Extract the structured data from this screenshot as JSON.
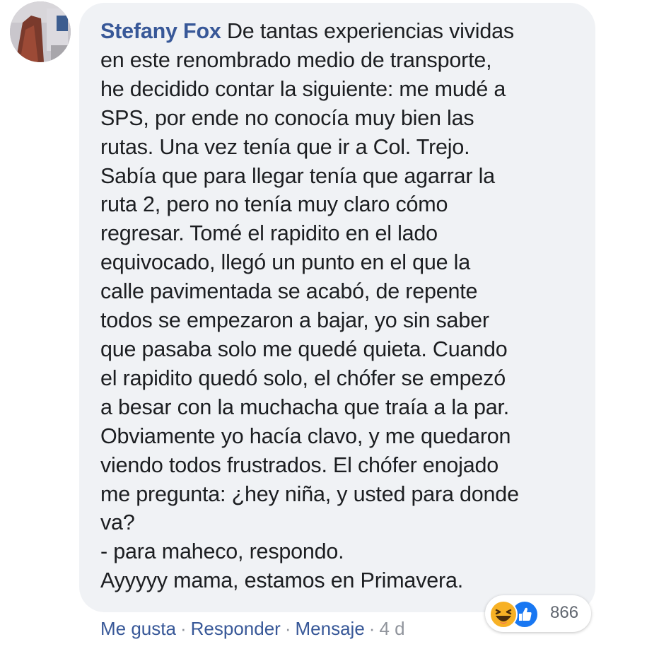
{
  "comment": {
    "author": "Stefany Fox",
    "lines": [
      " De tantas experiencias vividas",
      "en este renombrado medio de transporte,",
      "he decidido contar la siguiente: me mudé a",
      "SPS, por ende no conocía muy bien las",
      "rutas. Una vez tenía que ir a Col. Trejo.",
      "Sabía que para llegar tenía que agarrar la",
      "ruta 2, pero no tenía muy claro cómo",
      "regresar. Tomé el rapidito en el lado",
      "equivocado, llegó un punto en el que la",
      "calle pavimentada se acabó, de repente",
      "todos se empezaron a bajar, yo sin saber",
      "que pasaba solo me quedé quieta. Cuando",
      "el rapidito quedó solo, el chófer se empezó",
      "a besar con la muchacha que traía a la par.",
      "Obviamente yo hacía clavo, y me quedaron",
      "viendo todos frustrados. El chófer enojado",
      "me pregunta: ¿hey niña, y usted para donde",
      "va?",
      "- para maheco, respondo.",
      "Ayyyyy mama, estamos en Primavera."
    ]
  },
  "actions": {
    "like": "Me gusta",
    "separator": "·",
    "reply": "Responder",
    "message": "Mensaje",
    "time": "4 d"
  },
  "reactions": {
    "icons": [
      "haha-icon",
      "like-icon"
    ],
    "count": "866",
    "colors": {
      "haha": "#f7b125",
      "like": "#1877f2"
    }
  },
  "colors": {
    "author": "#385898",
    "text": "#1c1e21",
    "bubble": "#f0f2f5",
    "muted": "#90949c"
  }
}
